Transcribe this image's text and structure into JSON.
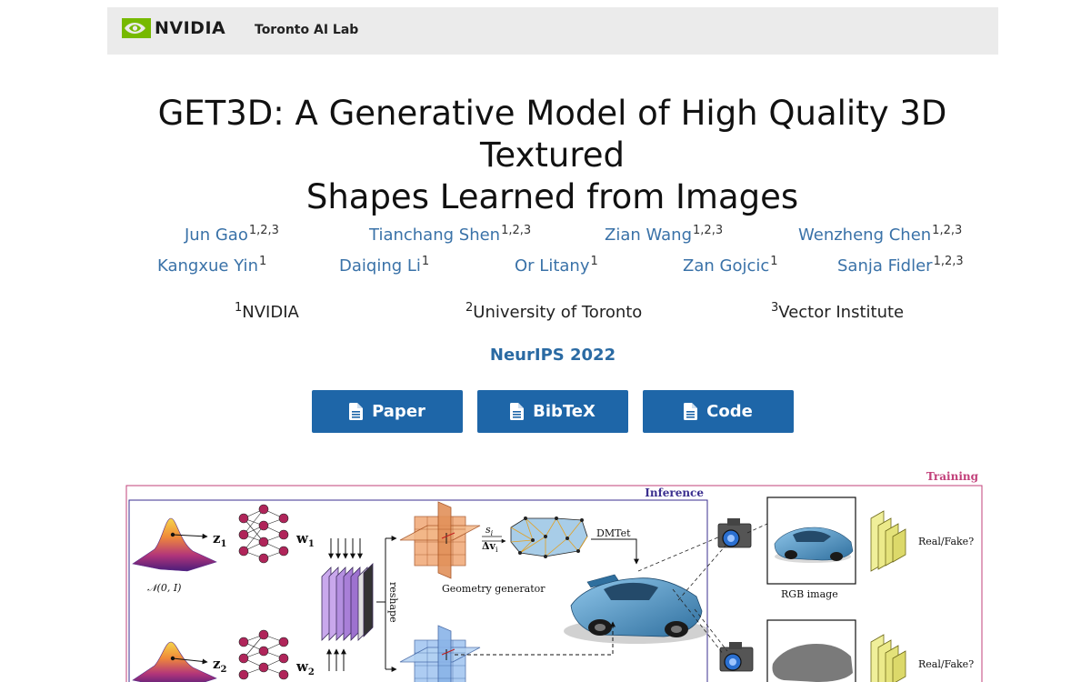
{
  "header": {
    "logo_text": "NVIDIA",
    "lab_name": "Toronto AI Lab"
  },
  "paper": {
    "title_line1": "GET3D: A Generative Model of High Quality 3D Textured",
    "title_line2": "Shapes Learned from Images",
    "venue": "NeurIPS 2022"
  },
  "authors": [
    {
      "name": "Jun Gao",
      "affil": "1,2,3"
    },
    {
      "name": "Tianchang Shen",
      "affil": "1,2,3"
    },
    {
      "name": "Zian Wang",
      "affil": "1,2,3"
    },
    {
      "name": "Wenzheng Chen",
      "affil": "1,2,3"
    },
    {
      "name": "Kangxue Yin",
      "affil": "1"
    },
    {
      "name": "Daiqing Li",
      "affil": "1"
    },
    {
      "name": "Or Litany",
      "affil": "1"
    },
    {
      "name": "Zan Gojcic",
      "affil": "1"
    },
    {
      "name": "Sanja Fidler",
      "affil": "1,2,3"
    }
  ],
  "affiliations": [
    {
      "num": "1",
      "name": "NVIDIA"
    },
    {
      "num": "2",
      "name": "University of Toronto"
    },
    {
      "num": "3",
      "name": "Vector Institute"
    }
  ],
  "buttons": {
    "paper": "Paper",
    "bibtex": "BibTeX",
    "code": "Code"
  },
  "figure": {
    "training_label": "Training",
    "inference_label": "Inference",
    "z1": "z",
    "z1_sub": "1",
    "z2": "z",
    "z2_sub": "2",
    "w1": "w",
    "w1_sub": "1",
    "w2": "w",
    "w2_sub": "2",
    "normal_dist": "𝒩(0, I)",
    "reshape": "reshape",
    "si": "s",
    "si_sub": "i",
    "dvi": "Δv",
    "dvi_sub": "i",
    "dmtet": "DMTet",
    "geometry_generator": "Geometry generator",
    "rgb_image": "RGB image",
    "real_fake_1": "Real/Fake?",
    "real_fake_2": "Real/Fake?"
  },
  "colors": {
    "nvidia_green": "#76b900",
    "link_blue": "#3a72a8",
    "button_blue": "#1e66a8",
    "training_pink": "#c2407a",
    "inference_purple": "#3b2f8f"
  }
}
